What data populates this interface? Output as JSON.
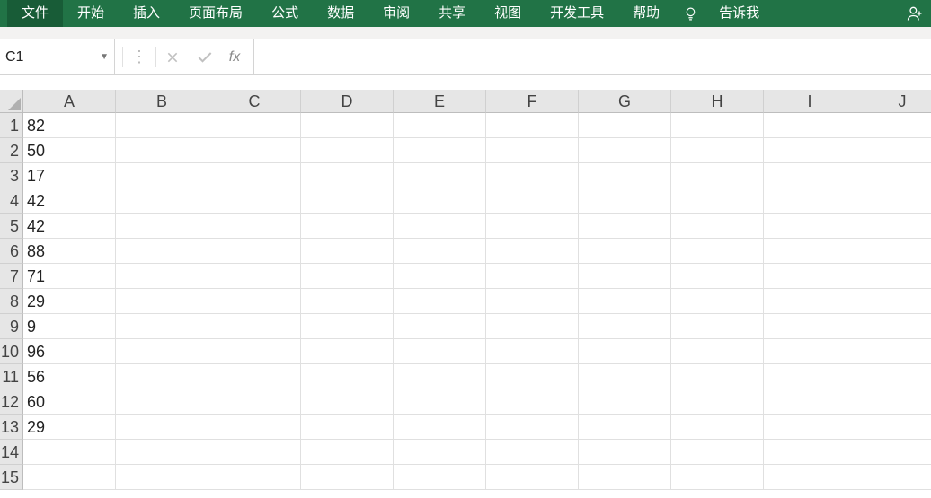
{
  "ribbon": {
    "tabs": [
      "文件",
      "开始",
      "插入",
      "页面布局",
      "公式",
      "数据",
      "审阅",
      "共享",
      "视图",
      "开发工具",
      "帮助"
    ],
    "tellme": "告诉我"
  },
  "formula_bar": {
    "name_box": "C1",
    "fx_label": "fx",
    "formula_value": ""
  },
  "columns": [
    "A",
    "B",
    "C",
    "D",
    "E",
    "F",
    "G",
    "H",
    "I",
    "J"
  ],
  "rows": [
    {
      "n": "1",
      "a": "82"
    },
    {
      "n": "2",
      "a": "50"
    },
    {
      "n": "3",
      "a": "17"
    },
    {
      "n": "4",
      "a": "42"
    },
    {
      "n": "5",
      "a": "42"
    },
    {
      "n": "6",
      "a": "88"
    },
    {
      "n": "7",
      "a": "71"
    },
    {
      "n": "8",
      "a": "29"
    },
    {
      "n": "9",
      "a": "9"
    },
    {
      "n": "10",
      "a": "96"
    },
    {
      "n": "11",
      "a": "56"
    },
    {
      "n": "12",
      "a": "60"
    },
    {
      "n": "13",
      "a": "29"
    },
    {
      "n": "14",
      "a": ""
    },
    {
      "n": "15",
      "a": ""
    }
  ]
}
